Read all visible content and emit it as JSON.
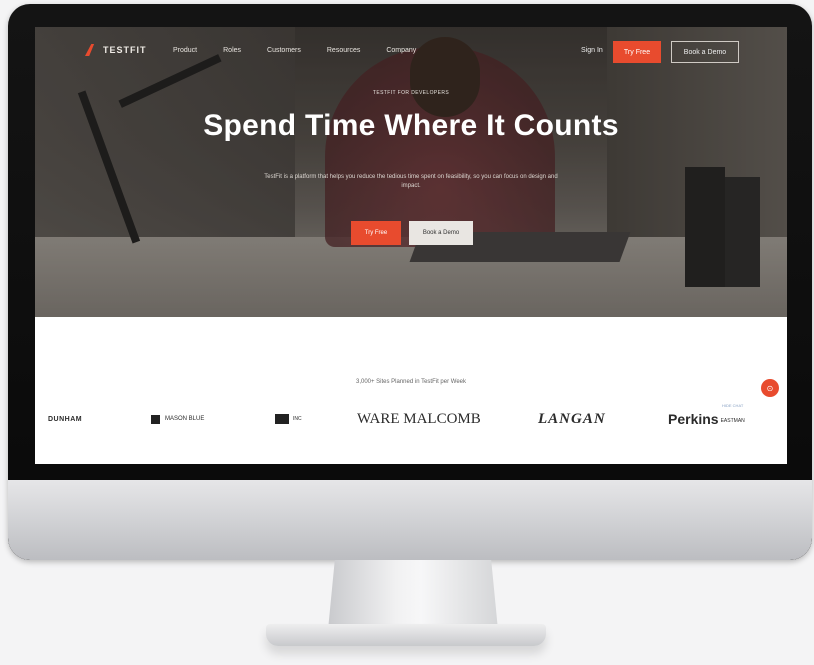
{
  "nav": {
    "logo_text": "TESTFIT",
    "links": [
      "Product",
      "Roles",
      "Customers",
      "Resources",
      "Company"
    ],
    "sign_in": "Sign In",
    "try_free": "Try Free",
    "book_demo": "Book a Demo"
  },
  "hero": {
    "eyebrow": "TESTFIT FOR DEVELOPERS",
    "headline": "Spend Time Where It Counts",
    "subtext": "TestFit is a platform that helps you reduce the tedious time spent on feasibility, so you can focus on design and impact.",
    "primary_cta": "Try Free",
    "secondary_cta": "Book a Demo"
  },
  "trust": {
    "heading": "3,000+ Sites Planned in TestFit per Week",
    "logos": [
      "DUNHAM",
      "MASON BLUE",
      "INC",
      "WARE MALCOMB",
      "LANGAN",
      "Perkins"
    ],
    "logo_suffix": "EASTMAN"
  },
  "widget": {
    "chat_icon": "chat-bubble-icon",
    "chat_glyph": "⊙",
    "tiny_text": "HIDE CHAT"
  },
  "colors": {
    "accent": "#e84b2e",
    "hero_overlay": "#3f3b38"
  }
}
